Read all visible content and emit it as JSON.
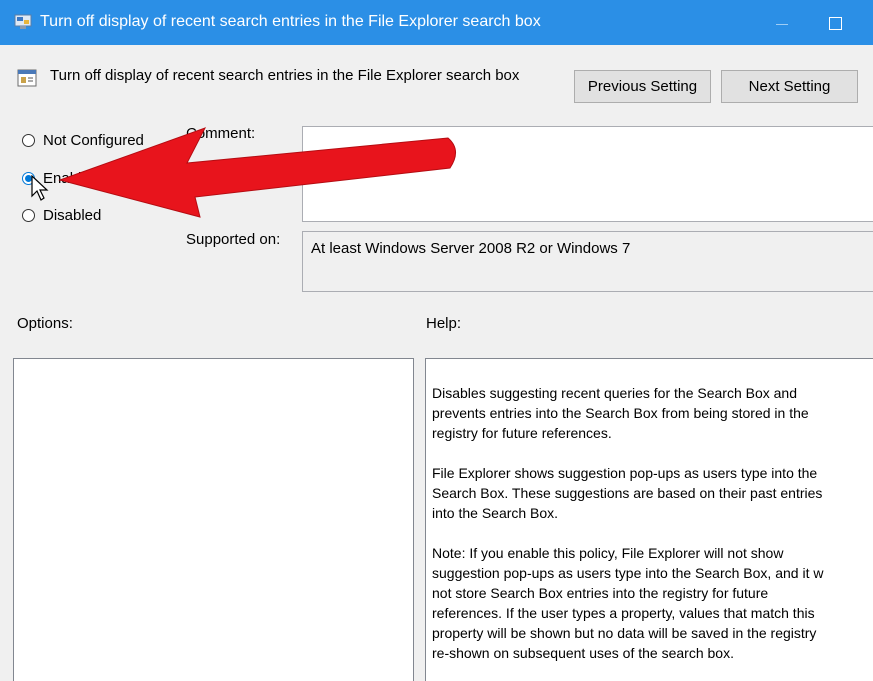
{
  "window": {
    "title": "Turn off display of recent search entries in the File Explorer search box"
  },
  "header": {
    "policy_name": "Turn off display of recent search entries in the File Explorer search box",
    "previous_label": "Previous Setting",
    "next_label": "Next Setting"
  },
  "state": {
    "options": [
      {
        "label": "Not Configured",
        "checked": false
      },
      {
        "label": "Enabled",
        "checked": true
      },
      {
        "label": "Disabled",
        "checked": false
      }
    ]
  },
  "fields": {
    "comment_label": "Comment:",
    "comment_value": "",
    "supported_label": "Supported on:",
    "supported_value": "At least Windows Server 2008 R2 or Windows 7"
  },
  "panes": {
    "options_label": "Options:",
    "help_label": "Help:",
    "help_paragraphs": [
      "Disables suggesting recent queries for the Search Box and\nprevents entries into the Search Box from being stored in the\nregistry for future references.",
      "File Explorer shows suggestion pop-ups as users type into the\nSearch Box.  These suggestions are based on their past entries\ninto the Search Box.",
      "Note: If you enable this policy, File Explorer will not show\nsuggestion pop-ups as users type into the Search Box, and it w\nnot store Search Box entries into the registry for future\nreferences.  If the user types a property, values that match this\nproperty will be shown but no data will be saved in the registry\nre-shown on subsequent uses of the search box."
    ]
  },
  "icons": {
    "app": "group-policy-icon",
    "policy": "policy-setting-icon",
    "minimize": "minimize-icon",
    "maximize": "maximize-icon",
    "annotation": "red-arrow",
    "cursor": "mouse-pointer-icon"
  },
  "colors": {
    "titlebar": "#2b8fe6",
    "dialog": "#f0f0f0",
    "radio_accent": "#0078d7",
    "arrow": "#e8141c"
  }
}
